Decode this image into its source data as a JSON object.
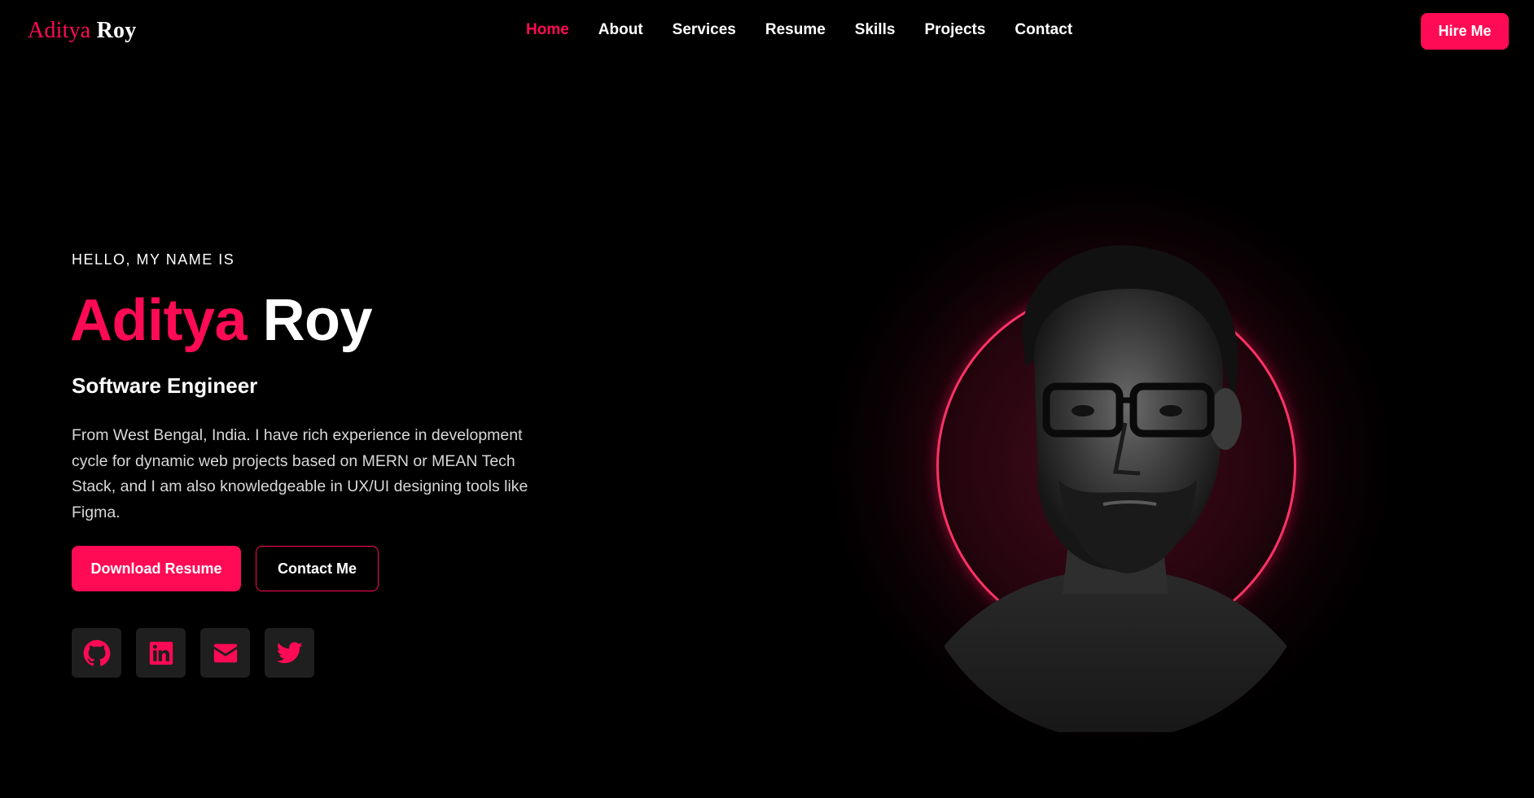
{
  "brand": {
    "first": "Aditya",
    "last": "Roy"
  },
  "nav": {
    "items": [
      {
        "label": "Home",
        "active": true
      },
      {
        "label": "About",
        "active": false
      },
      {
        "label": "Services",
        "active": false
      },
      {
        "label": "Resume",
        "active": false
      },
      {
        "label": "Skills",
        "active": false
      },
      {
        "label": "Projects",
        "active": false
      },
      {
        "label": "Contact",
        "active": false
      }
    ],
    "hire_label": "Hire Me"
  },
  "hero": {
    "greeting": "HELLO, MY NAME IS",
    "name_first": "Aditya",
    "name_last": "Roy",
    "role": "Software Engineer",
    "bio": "From West Bengal, India. I have rich experience in development cycle for dynamic web projects based on MERN or MEAN Tech Stack, and I am also knowledgeable in UX/UI designing tools like Figma.",
    "primary_button": "Download Resume",
    "secondary_button": "Contact Me"
  },
  "socials": [
    {
      "icon": "github-icon"
    },
    {
      "icon": "linkedin-icon"
    },
    {
      "icon": "email-icon"
    },
    {
      "icon": "twitter-icon"
    }
  ],
  "colors": {
    "accent": "#ff0a54",
    "background": "#000000",
    "social_bg": "#1f1f1f"
  }
}
